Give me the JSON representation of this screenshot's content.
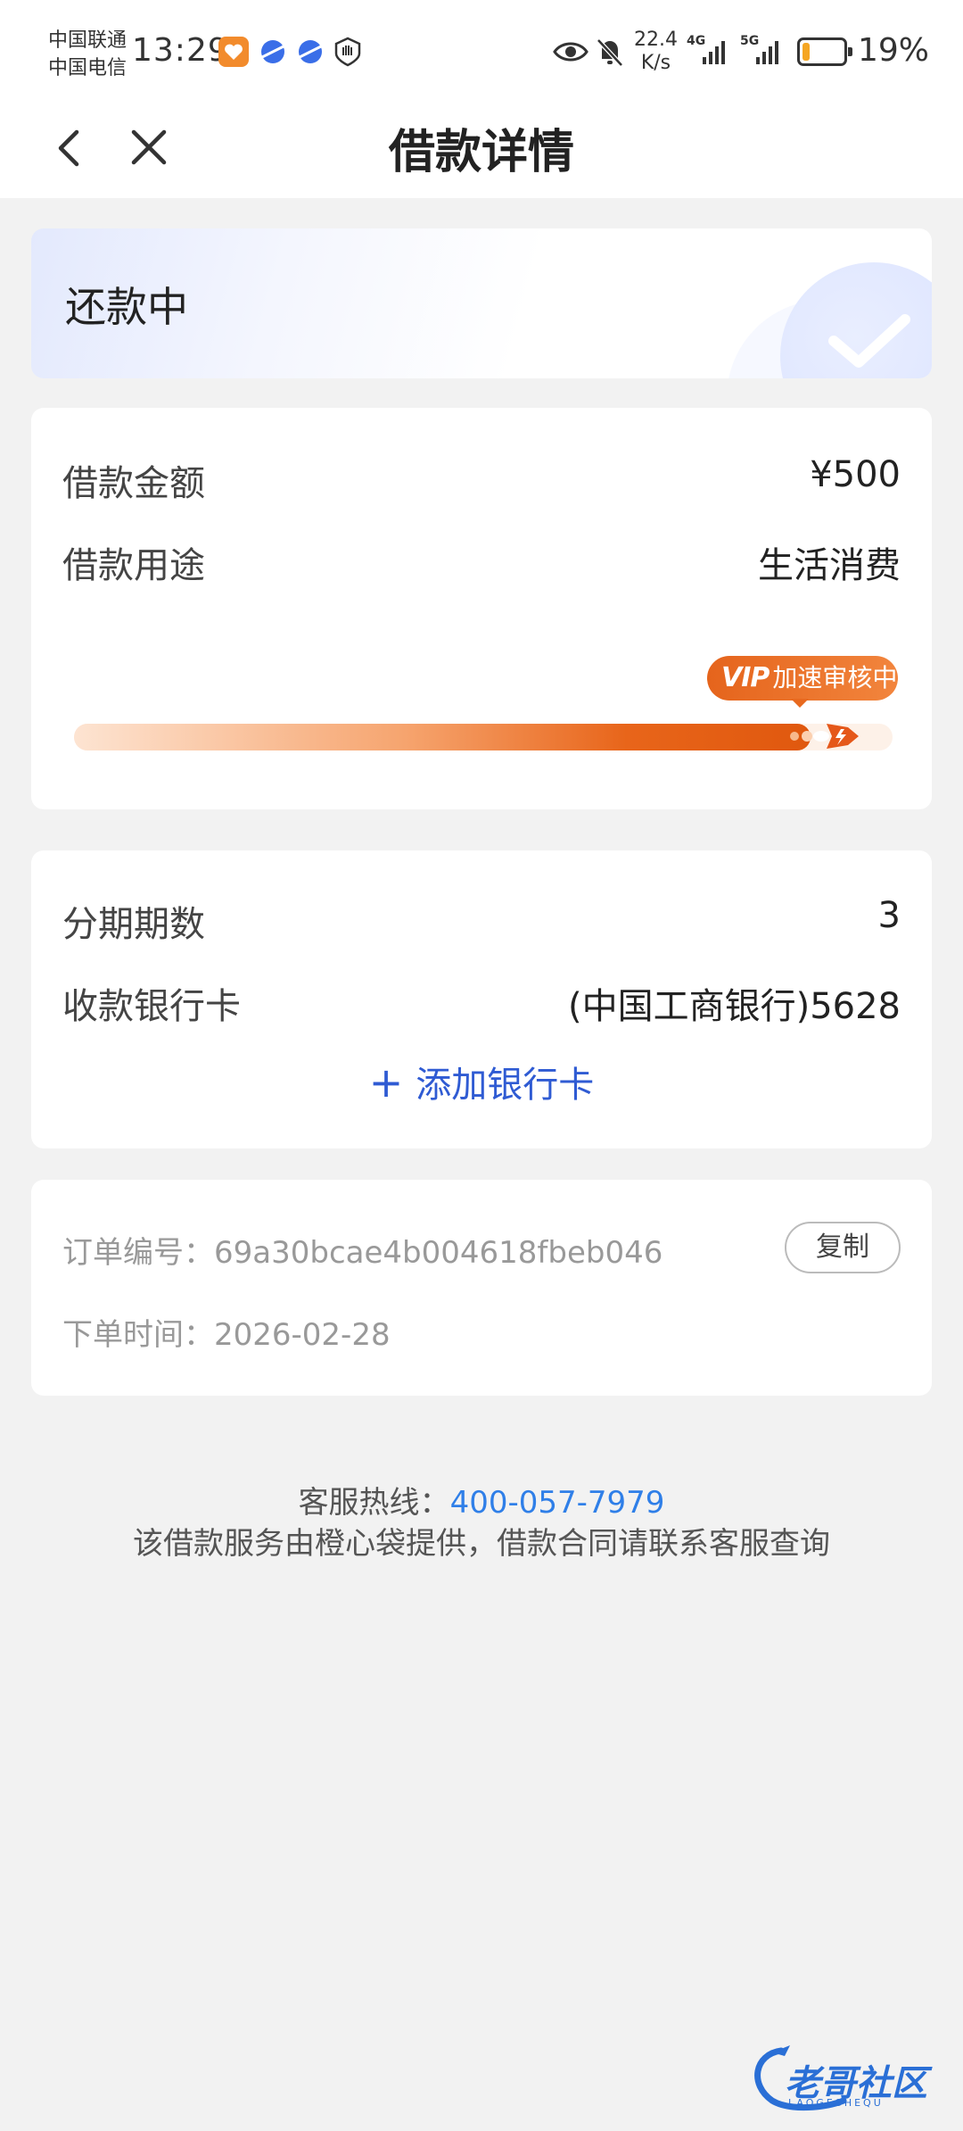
{
  "status_bar": {
    "carrier1": "中国联通",
    "carrier2": "中国电信",
    "time": "13:29",
    "speed_value": "22.4",
    "speed_unit": "K/s",
    "net1": "4G",
    "net2": "5G",
    "battery_percent": "19%",
    "battery_level": 0.19,
    "battery_color": "#f5a623"
  },
  "nav": {
    "title": "借款详情",
    "back_icon": "chevron-left",
    "close_icon": "x"
  },
  "status_card": {
    "text": "还款中",
    "icon": "check-circle"
  },
  "loan_info": {
    "amount_label": "借款金额",
    "amount_value": "¥500",
    "purpose_label": "借款用途",
    "purpose_value": "生活消费",
    "vip_badge_prefix": "VIP",
    "vip_badge_text": "加速审核中",
    "progress": 0.9
  },
  "installment": {
    "periods_label": "分期期数",
    "periods_value": "3",
    "bank_label": "收款银行卡",
    "bank_value": "(中国工商银行)5628",
    "add_card_label": "添加银行卡"
  },
  "order": {
    "order_no_label": "订单编号：",
    "order_no_value": "69a30bcae4b004618fbeb046",
    "copy_label": "复制",
    "time_label": "下单时间：",
    "time_value": "2026-02-28"
  },
  "footer": {
    "hotline_label": "客服热线：",
    "hotline_number": "400-057-7979",
    "disclaimer": "该借款服务由橙心袋提供，借款合同请联系客服查询"
  },
  "watermark": {
    "text": "老哥社区",
    "sub": "LAOGESHEQU"
  },
  "colors": {
    "accent_blue": "#2f5bd3",
    "link_blue": "#2f7fe8",
    "progress_orange": "#e8651a"
  }
}
